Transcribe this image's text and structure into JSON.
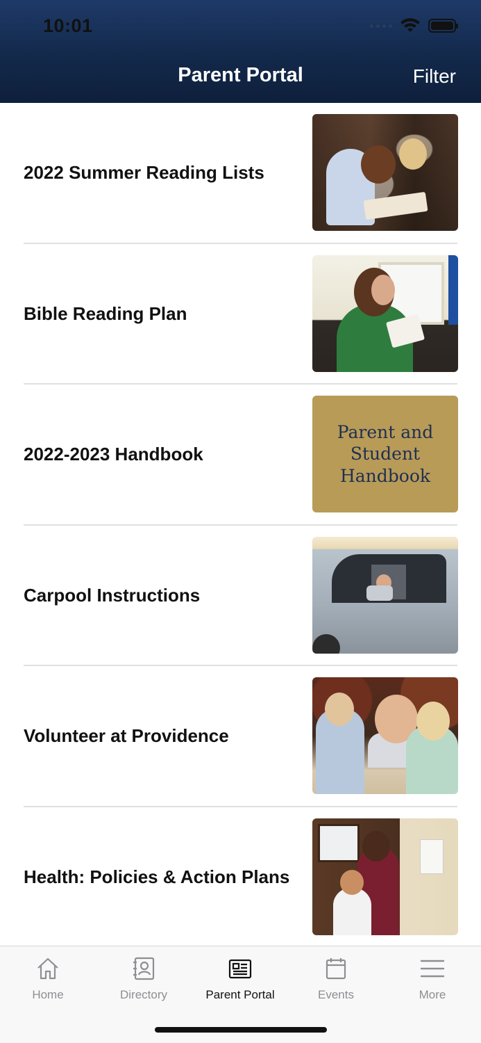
{
  "status_bar": {
    "time": "10:01"
  },
  "header": {
    "title": "Parent Portal",
    "filter_label": "Filter"
  },
  "items": [
    {
      "label": "2022 Summer Reading Lists",
      "thumb": "reading-photo"
    },
    {
      "label": "Bible Reading Plan",
      "thumb": "bible-photo"
    },
    {
      "label": "2022-2023 Handbook",
      "thumb": "handbook-cover",
      "thumb_text": "Parent and\nStudent\nHandbook"
    },
    {
      "label": "Carpool Instructions",
      "thumb": "carpool-photo"
    },
    {
      "label": "Volunteer at Providence",
      "thumb": "volunteer-photo"
    },
    {
      "label": "Health: Policies & Action Plans",
      "thumb": "health-photo"
    }
  ],
  "tabbar": {
    "tabs": [
      {
        "label": "Home",
        "icon": "home-icon"
      },
      {
        "label": "Directory",
        "icon": "contact-book-icon"
      },
      {
        "label": "Parent Portal",
        "icon": "newspaper-icon",
        "active": true
      },
      {
        "label": "Events",
        "icon": "calendar-icon"
      },
      {
        "label": "More",
        "icon": "menu-icon"
      }
    ]
  },
  "colors": {
    "header_dark": "#13294b",
    "handbook_gold": "#b89b57",
    "handbook_text": "#1f2f52"
  }
}
